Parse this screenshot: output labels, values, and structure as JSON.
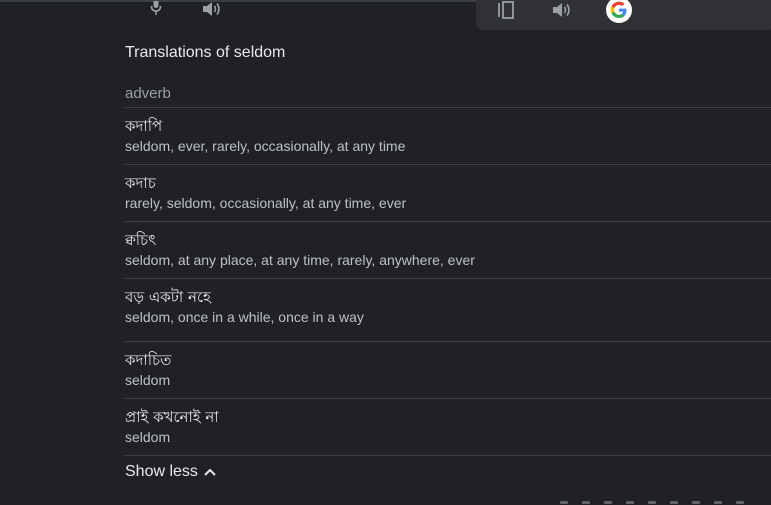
{
  "header": {
    "source_icons": [
      "mic-icon",
      "speaker-icon"
    ],
    "target_icons": [
      "copy-icon",
      "speaker-icon",
      "google-icon"
    ]
  },
  "translations": {
    "heading": "Translations of seldom",
    "part_of_speech": "adverb",
    "entries": [
      {
        "term": "কদাপি",
        "synonyms": "seldom, ever, rarely, occasionally, at any time"
      },
      {
        "term": "কদাচ",
        "synonyms": "rarely, seldom, occasionally, at any time, ever"
      },
      {
        "term": "ক্বচিৎ",
        "synonyms": "seldom, at any place, at any time, rarely, anywhere, ever"
      },
      {
        "term": "বড় একটা নহে",
        "synonyms": "seldom, once in a while, once in a way"
      },
      {
        "term": "কদাচিত",
        "synonyms": "seldom"
      },
      {
        "term": "প্রাই কখনোই না",
        "synonyms": "seldom"
      }
    ],
    "show_less_label": "Show less"
  },
  "colors": {
    "background": "#202124",
    "panel": "#303134",
    "divider": "#3c4043",
    "text_primary": "#e8eaed",
    "text_secondary": "#bdc1c6",
    "text_muted": "#9aa0a6"
  }
}
